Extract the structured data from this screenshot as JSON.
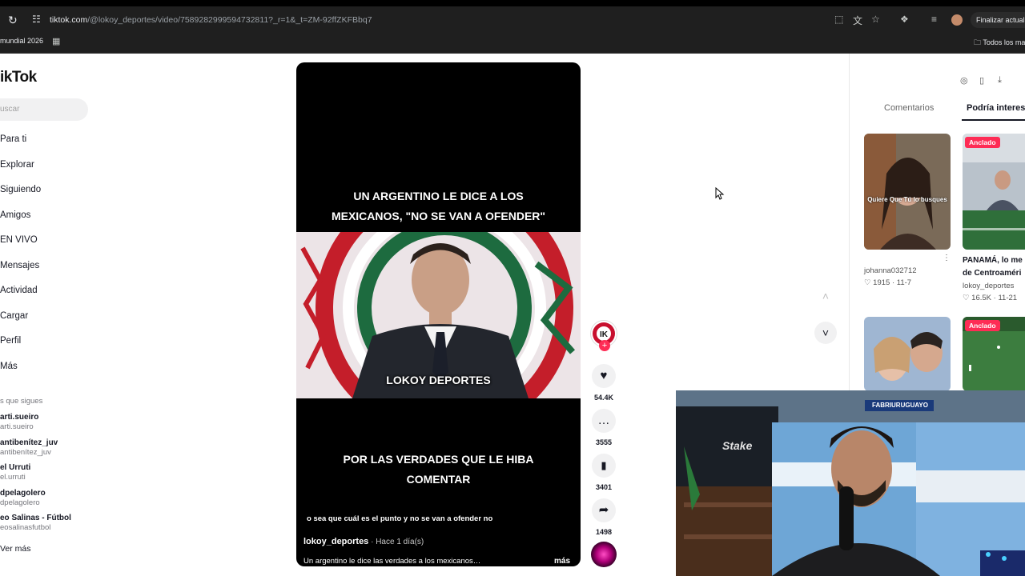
{
  "browser": {
    "url_domain": "tiktok.com",
    "url_rest": "/@lokoy_deportes/video/7589282999594732811?_r=1&_t=ZM-92ffZKFBbq7",
    "update_button": "Finalizar actualización",
    "bookmark_left": "mundial 2026",
    "bookmark_right": "Todos los ma"
  },
  "sidebar": {
    "logo": "ikTok",
    "search_placeholder": "uscar",
    "nav": [
      "Para ti",
      "Explorar",
      "Siguiendo",
      "Amigos",
      "EN VIVO",
      "Mensajes",
      "Actividad",
      "Cargar",
      "Perfil",
      "Más"
    ],
    "following_title": "s que sigues",
    "following": [
      {
        "name": "arti.sueiro",
        "handle": "arti.sueiro"
      },
      {
        "name": "antibenítez_juv",
        "handle": "antibenítez_juv"
      },
      {
        "name": "el Urruti",
        "handle": "el.urruti"
      },
      {
        "name": "dpelagolero",
        "handle": "dpelagolero"
      },
      {
        "name": "eo Salinas - Fútbol",
        "handle": "eosalinasfutbol"
      }
    ],
    "see_more": "Ver más"
  },
  "video": {
    "caption_top_1": "UN ARGENTINO LE DICE A LOS",
    "caption_top_2": "MEXICANOS, \"NO SE VAN A OFENDER\"",
    "overlay_text": "LOKOY DEPORTES",
    "caption_bottom_1": "POR LAS VERDADES QUE LE HIBA",
    "caption_bottom_2": "COMENTAR",
    "subtitle": "o sea que cuál es el punto y no se van a ofender no",
    "author": "lokoy_deportes",
    "time_ago": " · Hace 1 día(s)",
    "description": "Un argentino le dice las verdades a los mexicanos…",
    "more": "más"
  },
  "actions": {
    "likes": "54.4K",
    "comments": "3555",
    "saves": "3401",
    "shares": "1498"
  },
  "right_panel": {
    "tab_comments": "Comentarios",
    "tab_suggested": "Podría interesarte",
    "pinned_label": "Anclado",
    "cards": [
      {
        "caption": "Quiere Que Tú lo busques",
        "author": "johanna032712",
        "likes": "1915",
        "date": "11-7"
      },
      {
        "title_1": "PANAMÁ, lo me",
        "title_2": "de Centroaméri",
        "author": "lokoy_deportes",
        "likes": "16.5K",
        "date": "11-21"
      }
    ]
  },
  "webcam": {
    "name_tag": "FABRIURUGUAYO"
  },
  "colors": {
    "accent": "#fe2c55",
    "chrome_bg": "#1f1f1f"
  }
}
